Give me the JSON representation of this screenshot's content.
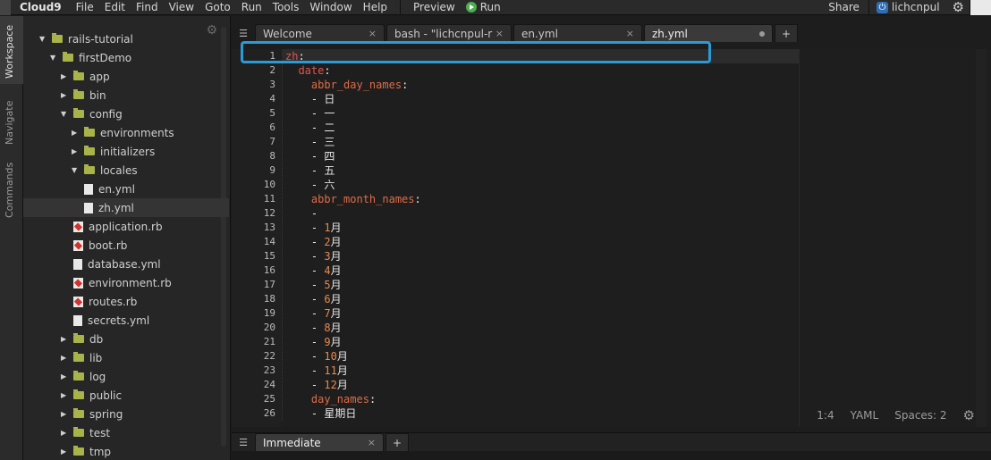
{
  "menubar": {
    "brand": "Cloud9",
    "items": [
      "File",
      "Edit",
      "Find",
      "View",
      "Goto",
      "Run",
      "Tools",
      "Window",
      "Help"
    ],
    "preview": "Preview",
    "run": "Run",
    "share": "Share",
    "user": "lichcnpul"
  },
  "rail": {
    "workspace": "Workspace",
    "navigate": "Navigate",
    "commands": "Commands"
  },
  "tree": [
    {
      "label": "rails-tutorial",
      "type": "folder",
      "open": true,
      "depth": 0
    },
    {
      "label": "firstDemo",
      "type": "folder",
      "open": true,
      "depth": 1
    },
    {
      "label": "app",
      "type": "folder",
      "open": false,
      "depth": 2
    },
    {
      "label": "bin",
      "type": "folder",
      "open": false,
      "depth": 2
    },
    {
      "label": "config",
      "type": "folder",
      "open": true,
      "depth": 2
    },
    {
      "label": "environments",
      "type": "folder",
      "open": false,
      "depth": 3
    },
    {
      "label": "initializers",
      "type": "folder",
      "open": false,
      "depth": 3
    },
    {
      "label": "locales",
      "type": "folder",
      "open": true,
      "depth": 3
    },
    {
      "label": "en.yml",
      "type": "file",
      "depth": 4
    },
    {
      "label": "zh.yml",
      "type": "file",
      "depth": 4,
      "selected": true
    },
    {
      "label": "application.rb",
      "type": "ruby",
      "depth": 3
    },
    {
      "label": "boot.rb",
      "type": "ruby",
      "depth": 3
    },
    {
      "label": "database.yml",
      "type": "file",
      "depth": 3
    },
    {
      "label": "environment.rb",
      "type": "ruby",
      "depth": 3
    },
    {
      "label": "routes.rb",
      "type": "ruby",
      "depth": 3
    },
    {
      "label": "secrets.yml",
      "type": "file",
      "depth": 3
    },
    {
      "label": "db",
      "type": "folder",
      "open": false,
      "depth": 2
    },
    {
      "label": "lib",
      "type": "folder",
      "open": false,
      "depth": 2
    },
    {
      "label": "log",
      "type": "folder",
      "open": false,
      "depth": 2
    },
    {
      "label": "public",
      "type": "folder",
      "open": false,
      "depth": 2
    },
    {
      "label": "spring",
      "type": "folder",
      "open": false,
      "depth": 2
    },
    {
      "label": "test",
      "type": "folder",
      "open": false,
      "depth": 2
    },
    {
      "label": "tmp",
      "type": "folder",
      "open": false,
      "depth": 2
    }
  ],
  "tabs": [
    {
      "label": "Welcome",
      "close": "×"
    },
    {
      "label": "bash - \"lichcnpul-rails",
      "close": "×"
    },
    {
      "label": "en.yml",
      "close": "×"
    },
    {
      "label": "zh.yml",
      "modified": true,
      "active": true
    }
  ],
  "code_lines": [
    [
      [
        "key",
        "zh"
      ],
      [
        "str",
        ":"
      ]
    ],
    [
      [
        "str",
        "  "
      ],
      [
        "key",
        "date"
      ],
      [
        "str",
        ":"
      ]
    ],
    [
      [
        "str",
        "    "
      ],
      [
        "key2",
        "abbr_day_names"
      ],
      [
        "str",
        ":"
      ]
    ],
    [
      [
        "str",
        "    - 日"
      ]
    ],
    [
      [
        "str",
        "    - 一"
      ]
    ],
    [
      [
        "str",
        "    - 二"
      ]
    ],
    [
      [
        "str",
        "    - 三"
      ]
    ],
    [
      [
        "str",
        "    - 四"
      ]
    ],
    [
      [
        "str",
        "    - 五"
      ]
    ],
    [
      [
        "str",
        "    - 六"
      ]
    ],
    [
      [
        "str",
        "    "
      ],
      [
        "key2",
        "abbr_month_names"
      ],
      [
        "str",
        ":"
      ]
    ],
    [
      [
        "str",
        "    -"
      ]
    ],
    [
      [
        "str",
        "    - "
      ],
      [
        "num",
        "1"
      ],
      [
        "str",
        "月"
      ]
    ],
    [
      [
        "str",
        "    - "
      ],
      [
        "num",
        "2"
      ],
      [
        "str",
        "月"
      ]
    ],
    [
      [
        "str",
        "    - "
      ],
      [
        "num",
        "3"
      ],
      [
        "str",
        "月"
      ]
    ],
    [
      [
        "str",
        "    - "
      ],
      [
        "num",
        "4"
      ],
      [
        "str",
        "月"
      ]
    ],
    [
      [
        "str",
        "    - "
      ],
      [
        "num",
        "5"
      ],
      [
        "str",
        "月"
      ]
    ],
    [
      [
        "str",
        "    - "
      ],
      [
        "num",
        "6"
      ],
      [
        "str",
        "月"
      ]
    ],
    [
      [
        "str",
        "    - "
      ],
      [
        "num",
        "7"
      ],
      [
        "str",
        "月"
      ]
    ],
    [
      [
        "str",
        "    - "
      ],
      [
        "num",
        "8"
      ],
      [
        "str",
        "月"
      ]
    ],
    [
      [
        "str",
        "    - "
      ],
      [
        "num",
        "9"
      ],
      [
        "str",
        "月"
      ]
    ],
    [
      [
        "str",
        "    - "
      ],
      [
        "num",
        "10"
      ],
      [
        "str",
        "月"
      ]
    ],
    [
      [
        "str",
        "    - "
      ],
      [
        "num",
        "11"
      ],
      [
        "str",
        "月"
      ]
    ],
    [
      [
        "str",
        "    - "
      ],
      [
        "num",
        "12"
      ],
      [
        "str",
        "月"
      ]
    ],
    [
      [
        "str",
        "    "
      ],
      [
        "key2",
        "day_names"
      ],
      [
        "str",
        ":"
      ]
    ],
    [
      [
        "str",
        "    - 星期日"
      ]
    ]
  ],
  "line_numbers": [
    "1",
    "2",
    "3",
    "4",
    "5",
    "6",
    "7",
    "8",
    "9",
    "10",
    "11",
    "12",
    "13",
    "14",
    "15",
    "16",
    "17",
    "18",
    "19",
    "20",
    "21",
    "22",
    "23",
    "24",
    "25",
    "26"
  ],
  "status": {
    "cursor": "1:4",
    "mode": "YAML",
    "spaces": "Spaces: 2"
  },
  "bottom_tabs": [
    {
      "label": "Immediate",
      "close": "×"
    }
  ]
}
